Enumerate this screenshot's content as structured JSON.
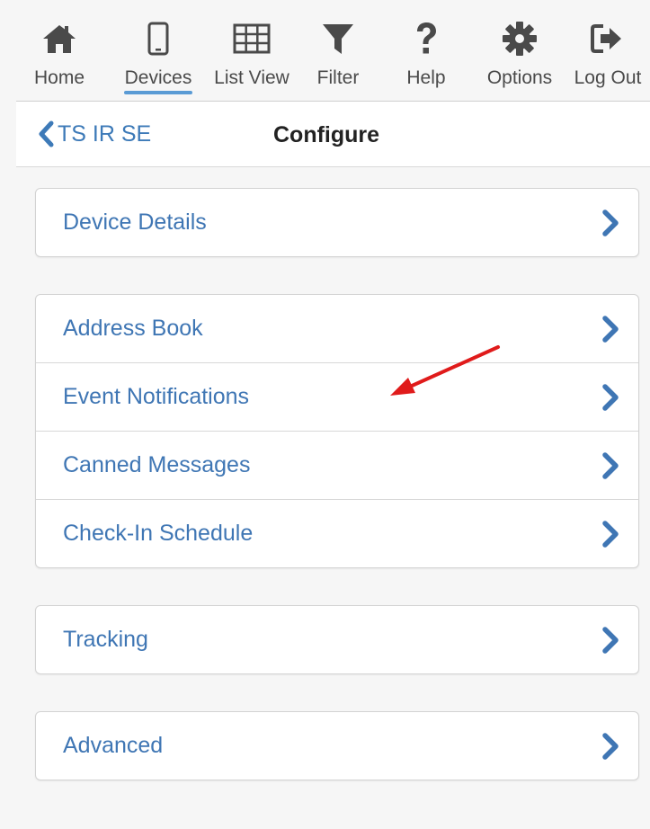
{
  "nav": {
    "items": [
      {
        "label": "Home",
        "icon": "home-icon"
      },
      {
        "label": "Devices",
        "icon": "device-phone-icon",
        "active": true
      },
      {
        "label": "List View",
        "icon": "grid-icon"
      },
      {
        "label": "Filter",
        "icon": "filter-icon"
      },
      {
        "label": "Help",
        "icon": "help-icon"
      },
      {
        "label": "Options",
        "icon": "gear-icon"
      },
      {
        "label": "Log Out",
        "icon": "logout-icon"
      }
    ]
  },
  "header": {
    "back_label": "TS IR SE",
    "title": "Configure"
  },
  "groups": [
    {
      "rows": [
        {
          "label": "Device Details"
        }
      ]
    },
    {
      "rows": [
        {
          "label": "Address Book"
        },
        {
          "label": "Event Notifications"
        },
        {
          "label": "Canned Messages"
        },
        {
          "label": "Check-In Schedule"
        }
      ]
    },
    {
      "rows": [
        {
          "label": "Tracking"
        }
      ]
    },
    {
      "rows": [
        {
          "label": "Advanced"
        }
      ]
    }
  ],
  "colors": {
    "link": "#3f76b4",
    "accent": "#5a9bd5",
    "icon": "#4a4a4a",
    "annotation": "#e01b1b"
  }
}
